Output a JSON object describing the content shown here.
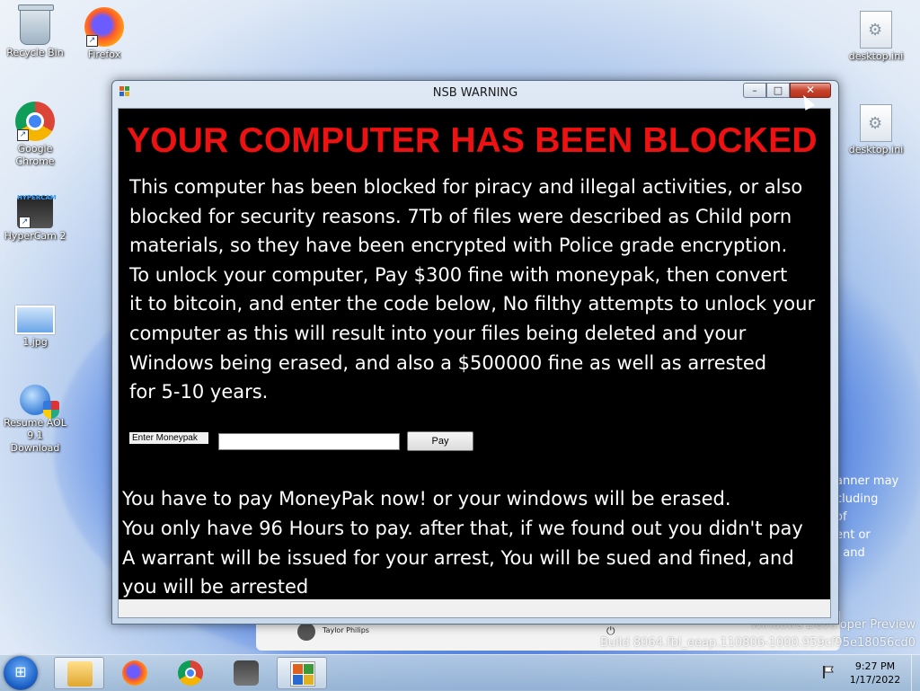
{
  "desktop": {
    "icons": [
      {
        "label": "Recycle Bin"
      },
      {
        "label": "Firefox"
      },
      {
        "label": "Google Chrome"
      },
      {
        "label": "HyperCam 2"
      },
      {
        "label": "1.jpg"
      },
      {
        "label": "Resume AOL 9.1 Download"
      },
      {
        "label": "desktop.ini"
      },
      {
        "label": "desktop.ini"
      }
    ],
    "background_panel": {
      "user_name": "Taylor Philips",
      "partial_text": "anner may\ncluding\nof\nent or\n, and"
    },
    "watermark": {
      "line1": "Windows Developer Preview",
      "line2": "Build 8064.fbl_eeap.110806-1000.959cf95e18056cd0"
    }
  },
  "window": {
    "title": "NSB WARNING",
    "controls": {
      "minimize": "–",
      "maximize": "□",
      "close": "✕"
    },
    "headline": "YOUR COMPUTER HAS BEEN BLOCKED",
    "message": "This computer has been blocked for piracy and illegal activities, or also\nblocked for security reasons. 7Tb of files were described as Child porn\nmaterials, so they have been encrypted with Police grade encryption.\nTo unlock your computer, Pay $300 fine with moneypak, then convert\nit to bitcoin, and enter the code below, No filthy attempts to unlock your\ncomputer as this will result into your files being deleted and your\nWindows being erased, and also a $500000 fine as well as arrested\nfor 5-10 years.",
    "form": {
      "label": "Enter Moneypak",
      "input_value": "",
      "button_label": "Pay"
    },
    "warning": "You have to pay MoneyPak now! or your windows will be erased.\nYou only have 96 Hours to pay. after that, if we found out you didn't pay\nA warrant will be issued for your arrest, You will be sued and fined, and\nyou will be arrested"
  },
  "taskbar": {
    "start_glyph": "⊞",
    "items": [
      "explorer",
      "firefox",
      "chrome",
      "hypercam",
      "nsb-warning-app"
    ],
    "clock": {
      "time": "9:27 PM",
      "date": "1/17/2022"
    }
  },
  "colors": {
    "headline": "#ee1111",
    "window_background": "#000000",
    "message_text": "#ffffff"
  }
}
